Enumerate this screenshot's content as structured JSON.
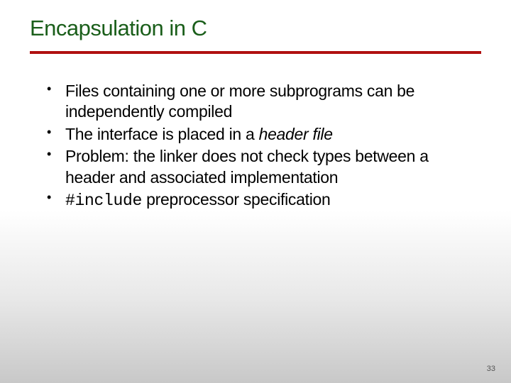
{
  "title": "Encapsulation in C",
  "bullets": {
    "b1": "Files containing one or more subprograms can be independently compiled",
    "b2_pre": "The interface is placed in a ",
    "b2_em": "header file",
    "b3": "Problem: the linker does not check types between a header and associated implementation",
    "b4_code": "#include",
    "b4_post": " preprocessor specification"
  },
  "page": "33"
}
